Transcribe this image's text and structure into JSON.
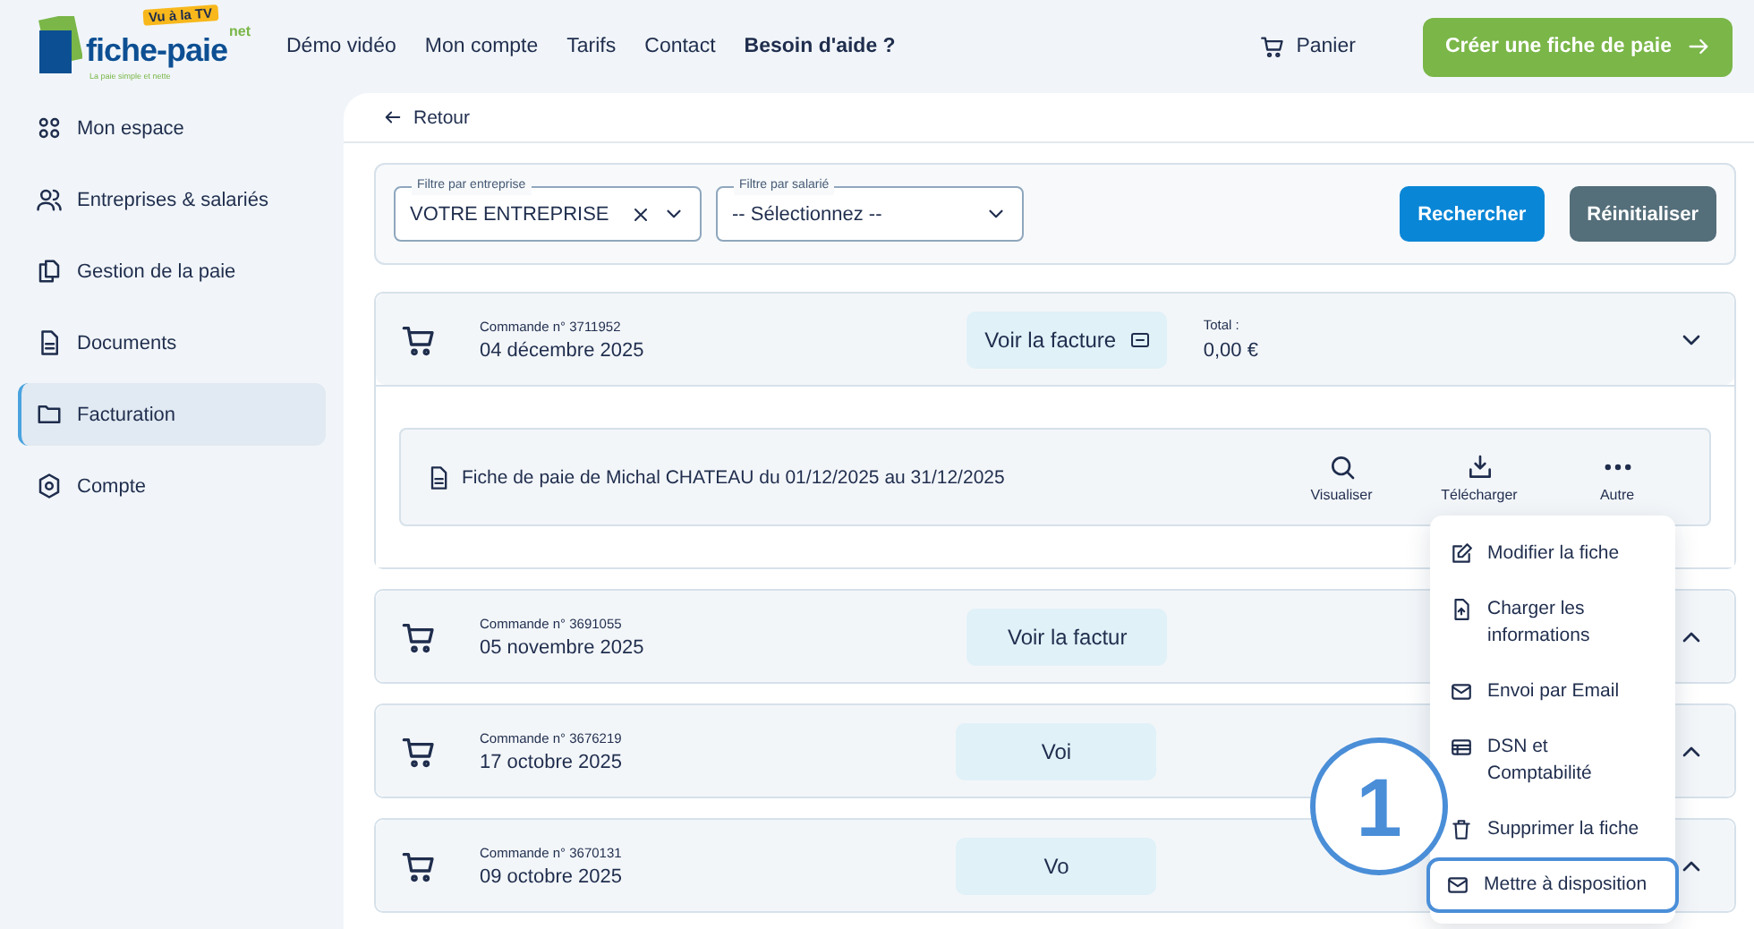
{
  "logo": {
    "name": "fiche-paie",
    "suffix": "net",
    "badge": "Vu à la TV",
    "tagline": "La paie simple et nette"
  },
  "nav": [
    {
      "label": "Démo vidéo",
      "bold": false
    },
    {
      "label": "Mon compte",
      "bold": false
    },
    {
      "label": "Tarifs",
      "bold": false
    },
    {
      "label": "Contact",
      "bold": false
    },
    {
      "label": "Besoin d'aide ?",
      "bold": true
    }
  ],
  "cart": {
    "label": "Panier"
  },
  "cta": {
    "label": "Créer une fiche de paie"
  },
  "sidebar": {
    "items": [
      {
        "label": "Mon espace",
        "selected": false
      },
      {
        "label": "Entreprises & salariés",
        "selected": false
      },
      {
        "label": "Gestion de la paie",
        "selected": false
      },
      {
        "label": "Documents",
        "selected": false
      },
      {
        "label": "Facturation",
        "selected": true
      },
      {
        "label": "Compte",
        "selected": false
      }
    ]
  },
  "back": {
    "label": "Retour"
  },
  "filters": [
    {
      "label": "Filtre par entreprise",
      "value": "VOTRE ENTREPRISE",
      "clearable": true
    },
    {
      "label": "Filtre par salarié",
      "value": "-- Sélectionnez --",
      "clearable": false
    }
  ],
  "buttons": [
    {
      "label": "Rechercher",
      "kind": "primary"
    },
    {
      "label": "Réinitialiser",
      "kind": "secondary"
    }
  ],
  "orders": [
    {
      "number": "Commande n° 3711952",
      "date": "04 décembre 2025",
      "invoice": "Voir la facture",
      "total_label": "Total :",
      "total": "0,00 €",
      "expanded": true,
      "payslips": [
        {
          "title": "Fiche de paie de Michal CHATEAU du 01/12/2025 au 31/12/2025",
          "actions": [
            "Visualiser",
            "Télécharger",
            "Autre"
          ]
        }
      ]
    },
    {
      "number": "Commande n° 3691055",
      "date": "05 novembre 2025",
      "invoice": "Voir la factur",
      "expanded": false
    },
    {
      "number": "Commande n° 3676219",
      "date": "17 octobre 2025",
      "invoice": "Voi",
      "expanded": false
    },
    {
      "number": "Commande n° 3670131",
      "date": "09 octobre 2025",
      "invoice": "Vo",
      "expanded": false
    }
  ],
  "menu": {
    "items": [
      {
        "label": "Modifier la fiche",
        "selected": false
      },
      {
        "label": "Charger les informations",
        "selected": false
      },
      {
        "label": "Envoi par Email",
        "selected": false
      },
      {
        "label": "DSN et Comptabilité",
        "selected": false
      },
      {
        "label": "Supprimer la fiche",
        "selected": false
      },
      {
        "label": "Mettre à disposition",
        "selected": true
      }
    ]
  },
  "callout": {
    "label": "1"
  }
}
